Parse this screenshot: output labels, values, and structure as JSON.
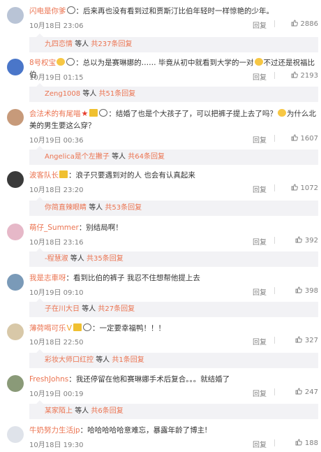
{
  "reply_label": "回复",
  "replies_label": "等人",
  "comments": [
    {
      "avatar_color": "#b9c4d6",
      "user": "闪电是你爹",
      "badges": [
        "panda"
      ],
      "text": "：后来再也没有看到过和贾斯汀比伯年轻时一样惊艳的少年。",
      "time": "10月18日 23:06",
      "likes": "2886",
      "reply_user": "九四恋情",
      "reply_suffix": "等人",
      "reply_link": "共237条回复"
    },
    {
      "avatar_color": "#4a76c9",
      "user": "8号权宝",
      "badges": [
        "emoji",
        "panda"
      ],
      "text": "：总以为是赛琳娜的……  毕竟从初中就看到大学的一对",
      "text2": "不过还是祝福比伯",
      "time": "10月19日 01:15",
      "likes": "2193",
      "reply_user": "Zeng1008",
      "reply_suffix": "等人",
      "reply_link": "共51条回复"
    },
    {
      "avatar_color": "#c79a7a",
      "user": "会法术的有尾喵",
      "badges": [
        "star",
        "crown",
        "panda"
      ],
      "text": "：结婚了也是个大孩子了，可以把裤子提上去了吗？",
      "text2": "为什么北美的男生要这么穿？",
      "time": "10月19日 00:36",
      "likes": "1607",
      "reply_user": "Angelica是个左撇子",
      "reply_suffix": "等人",
      "reply_link": "共64条回复"
    },
    {
      "avatar_color": "#3a3a3a",
      "user": "波客队长",
      "badges": [
        "crown"
      ],
      "text": "：浪子只要遇到对的人 也会有认真起来",
      "time": "10月18日 23:20",
      "likes": "1072",
      "reply_user": "你简直辣眼睛",
      "reply_suffix": "等人",
      "reply_link": "共53条回复"
    },
    {
      "avatar_color": "#e6b8c8",
      "user": "萌仔_Summer",
      "badges": [],
      "text": "：别结局啊！",
      "time": "10月18日 23:16",
      "likes": "392",
      "reply_user": "-程慧淑",
      "reply_suffix": "等人",
      "reply_link": "共35条回复"
    },
    {
      "avatar_color": "#7a9ab8",
      "user": "我是志車呀",
      "badges": [],
      "text": "：看到比伯的裤子 我忍不住想帮他提上去",
      "time": "10月19日 09:10",
      "likes": "398",
      "reply_user": "子在川大日",
      "reply_suffix": "等人",
      "reply_link": "共27条回复"
    },
    {
      "avatar_color": "#d8c8a8",
      "user": "薄荷喝可乐",
      "badges": [
        "heart",
        "crown",
        "panda"
      ],
      "text": "：一定要幸福鸭！！！",
      "time": "10月18日 22:50",
      "likes": "327",
      "reply_user": "彩妆大师口红控",
      "reply_suffix": "等人",
      "reply_link": "共1条回复"
    },
    {
      "avatar_color": "#8a9a78",
      "user": "FreshJohns",
      "badges": [],
      "text": "：我还停留在他和赛琳娜手术后复合。。。就结婚了",
      "time": "10月19日 00:19",
      "likes": "247",
      "reply_user": "某家陌上",
      "reply_suffix": "等人",
      "reply_link": "共6条回复"
    },
    {
      "avatar_color": "#dfe3ea",
      "user": "牛奶努力生活jp",
      "badges": [],
      "text": "：哈哈哈哈哈意难忘，暴露年龄了博主!",
      "time": "10月18日 19:30",
      "likes": "188"
    }
  ]
}
